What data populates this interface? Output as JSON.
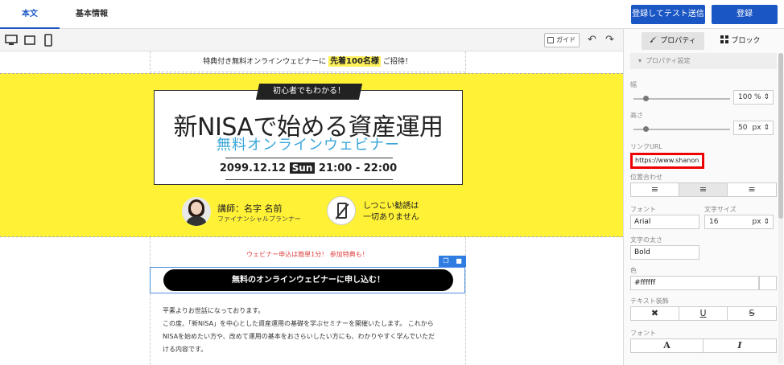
{
  "top": {
    "tab_body": "本文",
    "tab_basic": "基本情報",
    "btn_test": "登録してテスト送信",
    "btn_register": "登録"
  },
  "toolbar": {
    "guide": "ガイド",
    "undo_icon": "↶",
    "redo_icon": "↷"
  },
  "email": {
    "headline_pre": "特典付き無料オンラインウェビナーに",
    "headline_highlight": "先着100名様",
    "headline_post": "ご招待！",
    "badge": "初心者でもわかる！",
    "title": "新NISAで始める資産運用",
    "subtitle": "無料オンラインウェビナー",
    "date": "2099.12.12",
    "day": "Sun",
    "time": "21:00 - 22:00",
    "lecturer_name": "講師：名字 名前",
    "lecturer_role": "ファイナンシャルプランナー",
    "nophone_line1": "しつこい勧誘は",
    "nophone_line2": "一切ありません",
    "cta_note": "ウェビナー申込は簡単1分！ 参加特典も！",
    "cta_button": "無料のオンラインウェビナーに申し込む！",
    "body_line1": "平素よりお世話になっております。",
    "body_line2": "この度、「新NISA」を中心とした資産運用の基礎を学ぶセミナーを開催いたします。 これから",
    "body_line3": "NISAを始めたい方や、改めて運用の基本をおさらいしたい方にも、わかりやすく学んでいただ",
    "body_line4": "ける内容です。"
  },
  "panel": {
    "tab_property": "プロパティ",
    "tab_block": "ブロック",
    "section": "プロパティ設定",
    "width_label": "幅",
    "width_value": "100",
    "width_unit": "%",
    "height_label": "高さ",
    "height_value": "50",
    "height_unit": "px",
    "link_label": "リンクURL",
    "link_value": "https://www.shanon",
    "align_label": "位置合わせ",
    "font_label": "フォント",
    "font_value": "Arial",
    "size_label": "文字サイズ",
    "size_value": "16",
    "size_unit": "px",
    "weight_label": "文字の太さ",
    "weight_value": "Bold",
    "color_label": "色",
    "color_value": "#ffffff",
    "decor_label": "テキスト装飾",
    "decor_x": "✖",
    "decor_u": "U",
    "decor_s": "S",
    "font2_label": "フォント",
    "font_a": "A",
    "font_i": "I"
  },
  "colors": {
    "accent": "#1a56c4",
    "banner_yellow": "#fff135",
    "subtitle_blue": "#3aa6d8",
    "highlight_red": "#e00000"
  }
}
